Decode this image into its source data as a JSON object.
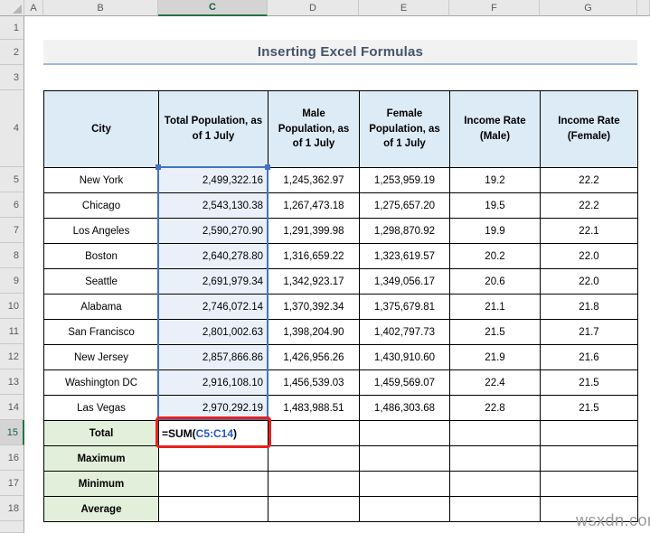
{
  "sheet": {
    "title": "Inserting Excel Formulas",
    "watermark": "wsxdn.com",
    "column_headers": [
      "A",
      "B",
      "C",
      "D",
      "E",
      "F",
      "G"
    ],
    "selected_column": "C",
    "row_headers": [
      "1",
      "2",
      "3",
      "4",
      "5",
      "6",
      "7",
      "8",
      "9",
      "10",
      "11",
      "12",
      "13",
      "14",
      "15",
      "16",
      "17",
      "18"
    ],
    "selected_row": "15",
    "active_cell": "C15",
    "selected_range": "C5:C14",
    "colors": {
      "selection_blue": "#4472C4",
      "table_header_fill": "#DDEBF7",
      "summary_label_fill": "#E2EFDA",
      "highlight_red": "#E8201E",
      "title_text": "#44546A",
      "range_reference_blue": "#2653C9",
      "active_header_green": "#217346"
    },
    "table": {
      "headers": [
        "City",
        "Total Population, as of 1 July",
        "Male Population, as of 1 July",
        "Female Population, as of 1 July",
        "Income Rate (Male)",
        "Income Rate (Female)"
      ],
      "rows": [
        [
          "New York",
          "2,499,322.16",
          "1,245,362.97",
          "1,253,959.19",
          "19.2",
          "22.2"
        ],
        [
          "Chicago",
          "2,543,130.38",
          "1,267,473.18",
          "1,275,657.20",
          "19.5",
          "22.2"
        ],
        [
          "Los Angeles",
          "2,590,270.90",
          "1,291,399.98",
          "1,298,870.92",
          "19.9",
          "22.1"
        ],
        [
          "Boston",
          "2,640,278.80",
          "1,316,659.22",
          "1,323,619.57",
          "20.2",
          "22.0"
        ],
        [
          "Seattle",
          "2,691,979.34",
          "1,342,923.17",
          "1,349,056.17",
          "20.6",
          "22.0"
        ],
        [
          "Alabama",
          "2,746,072.14",
          "1,370,392.34",
          "1,375,679.81",
          "21.1",
          "21.8"
        ],
        [
          "San Francisco",
          "2,801,002.63",
          "1,398,204.90",
          "1,402,797.73",
          "21.5",
          "21.7"
        ],
        [
          "New Jersey",
          "2,857,866.86",
          "1,426,956.26",
          "1,430,910.60",
          "21.9",
          "21.6"
        ],
        [
          "Washington DC",
          "2,916,108.10",
          "1,456,539.03",
          "1,459,569.07",
          "22.4",
          "21.5"
        ],
        [
          "Las Vegas",
          "2,970,292.19",
          "1,483,988.51",
          "1,486,303.68",
          "22.8",
          "21.5"
        ]
      ],
      "summary_rows": [
        {
          "label": "Total",
          "formula": {
            "prefix": "=SUM(",
            "range": "C5:C14",
            "suffix": ")"
          }
        },
        {
          "label": "Maximum"
        },
        {
          "label": "Minimum"
        },
        {
          "label": "Average"
        }
      ]
    }
  }
}
